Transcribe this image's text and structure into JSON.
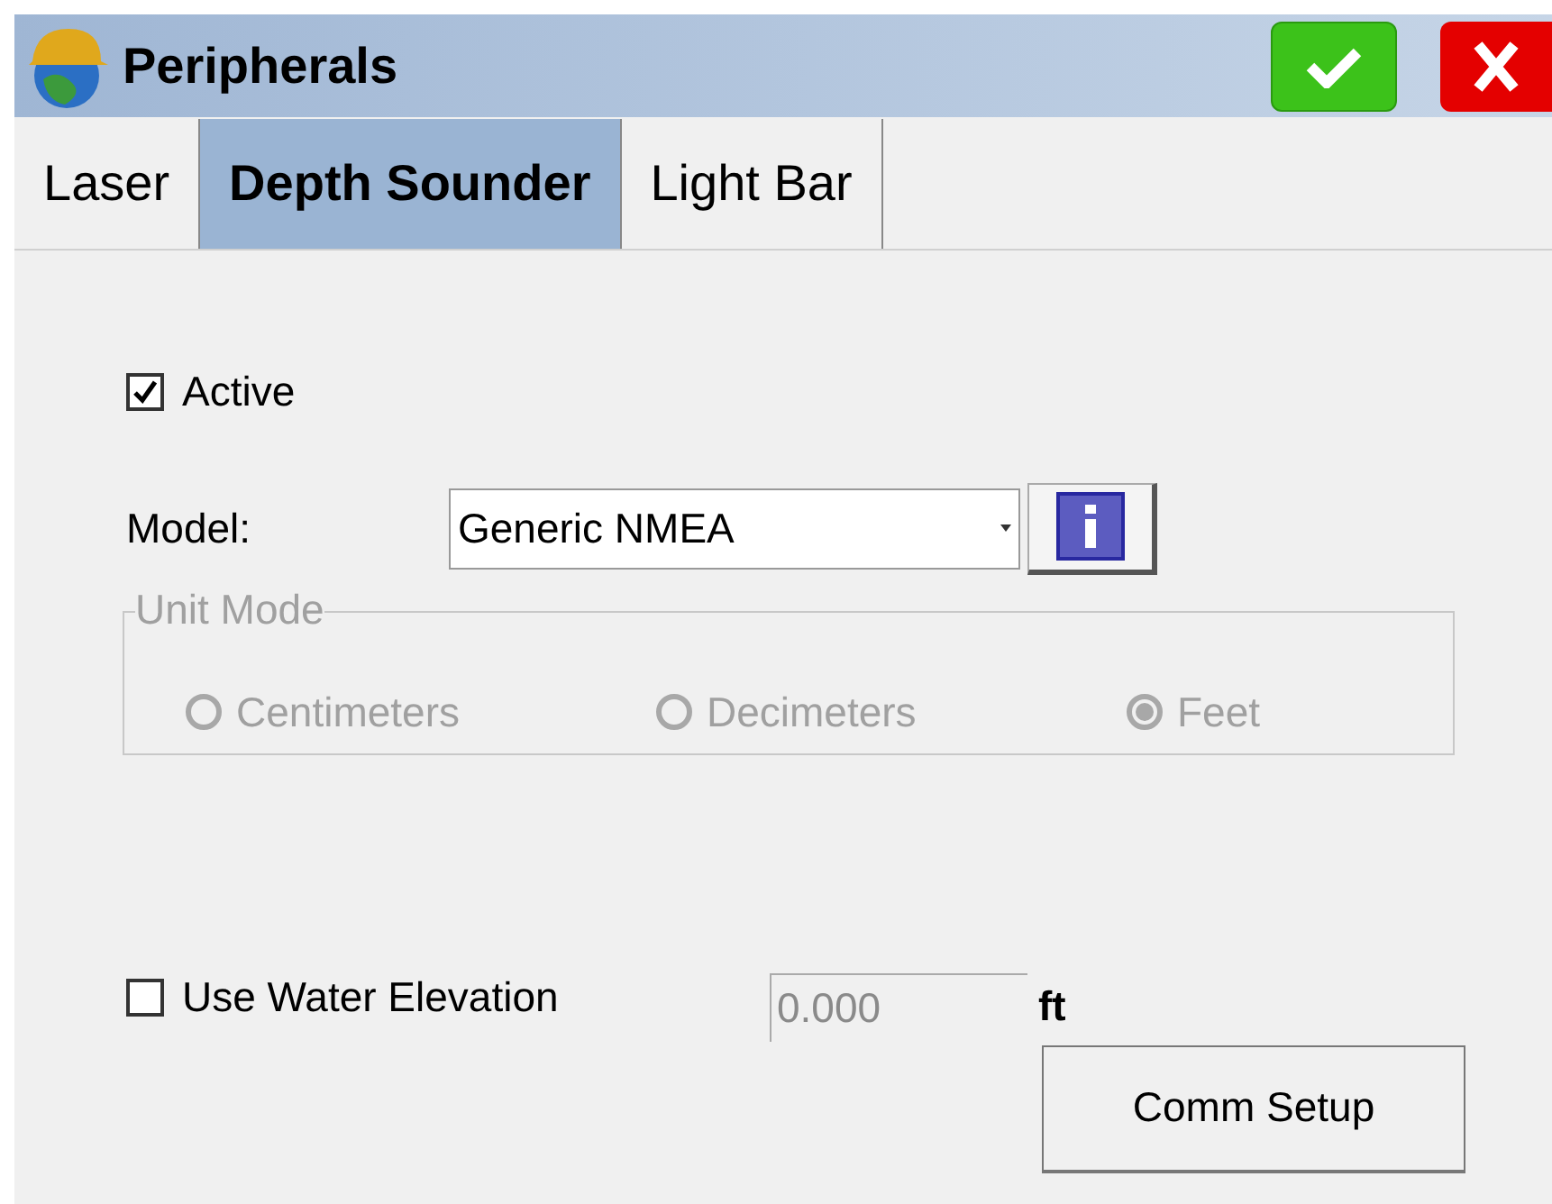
{
  "window": {
    "title": "Peripherals"
  },
  "tabs": [
    {
      "label": "Laser",
      "selected": false
    },
    {
      "label": "Depth Sounder",
      "selected": true
    },
    {
      "label": "Light Bar",
      "selected": false
    }
  ],
  "active": {
    "label": "Active",
    "checked": true
  },
  "model": {
    "label": "Model:",
    "value": "Generic NMEA"
  },
  "unit_mode": {
    "title": "Unit Mode",
    "disabled": true,
    "options": [
      {
        "label": "Centimeters",
        "selected": false
      },
      {
        "label": "Decimeters",
        "selected": false
      },
      {
        "label": "Feet",
        "selected": true
      }
    ]
  },
  "water_elevation": {
    "label": "Use Water Elevation",
    "checked": false,
    "value": "0.000",
    "disabled": true,
    "unit": "ft"
  },
  "buttons": {
    "comm_setup": "Comm Setup"
  }
}
